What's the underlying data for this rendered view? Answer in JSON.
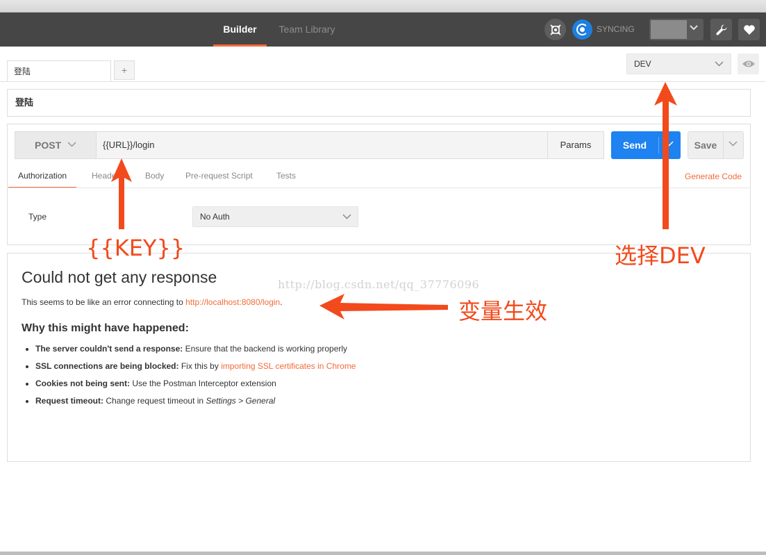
{
  "header": {
    "tabs": [
      {
        "label": "Builder",
        "active": true
      },
      {
        "label": "Team Library",
        "active": false
      }
    ],
    "sync_label": "SYNCING",
    "icons": [
      "interceptor-icon",
      "sync-icon",
      "user-avatar",
      "chevron-down-icon",
      "wrench-icon",
      "heart-icon"
    ],
    "accent_color": "#f26b3a",
    "sync_color": "#1e7fe0"
  },
  "tabs_row": {
    "request_tab": "登陆",
    "add_tab": "+",
    "environment": "DEV"
  },
  "request": {
    "name": "登陆",
    "method": "POST",
    "url": "{{URL}}/login",
    "params_label": "Params",
    "send_label": "Send",
    "save_label": "Save",
    "subtabs": [
      "Authorization",
      "Headers",
      "Body",
      "Pre-request Script",
      "Tests"
    ],
    "active_subtab": "Authorization",
    "generate_code": "Generate Code",
    "auth": {
      "type_label": "Type",
      "type_value": "No Auth"
    },
    "send_color": "#1e82f0"
  },
  "response": {
    "title": "Could not get any response",
    "message_prefix": "This seems to be like an error connecting to ",
    "message_link": "http://localhost:8080/login",
    "message_suffix": ".",
    "why_title": "Why this might have happened:",
    "reasons": [
      {
        "bold": "The server couldn't send a response:",
        "text": " Ensure that the backend is working properly"
      },
      {
        "bold": "SSL connections are being blocked:",
        "text": " Fix this by ",
        "link": "importing SSL certificates in Chrome"
      },
      {
        "bold": "Cookies not being sent:",
        "text": " Use the Postman Interceptor extension"
      },
      {
        "bold": "Request timeout:",
        "text": " Change request timeout in ",
        "italic": "Settings > General"
      }
    ]
  },
  "watermark": "http://blog.csdn.net/qq_37776096",
  "annotations": {
    "key_label": "{{KEY}}",
    "dev_label": "选择DEV",
    "var_label": "变量生效",
    "color": "#f24a1c"
  }
}
